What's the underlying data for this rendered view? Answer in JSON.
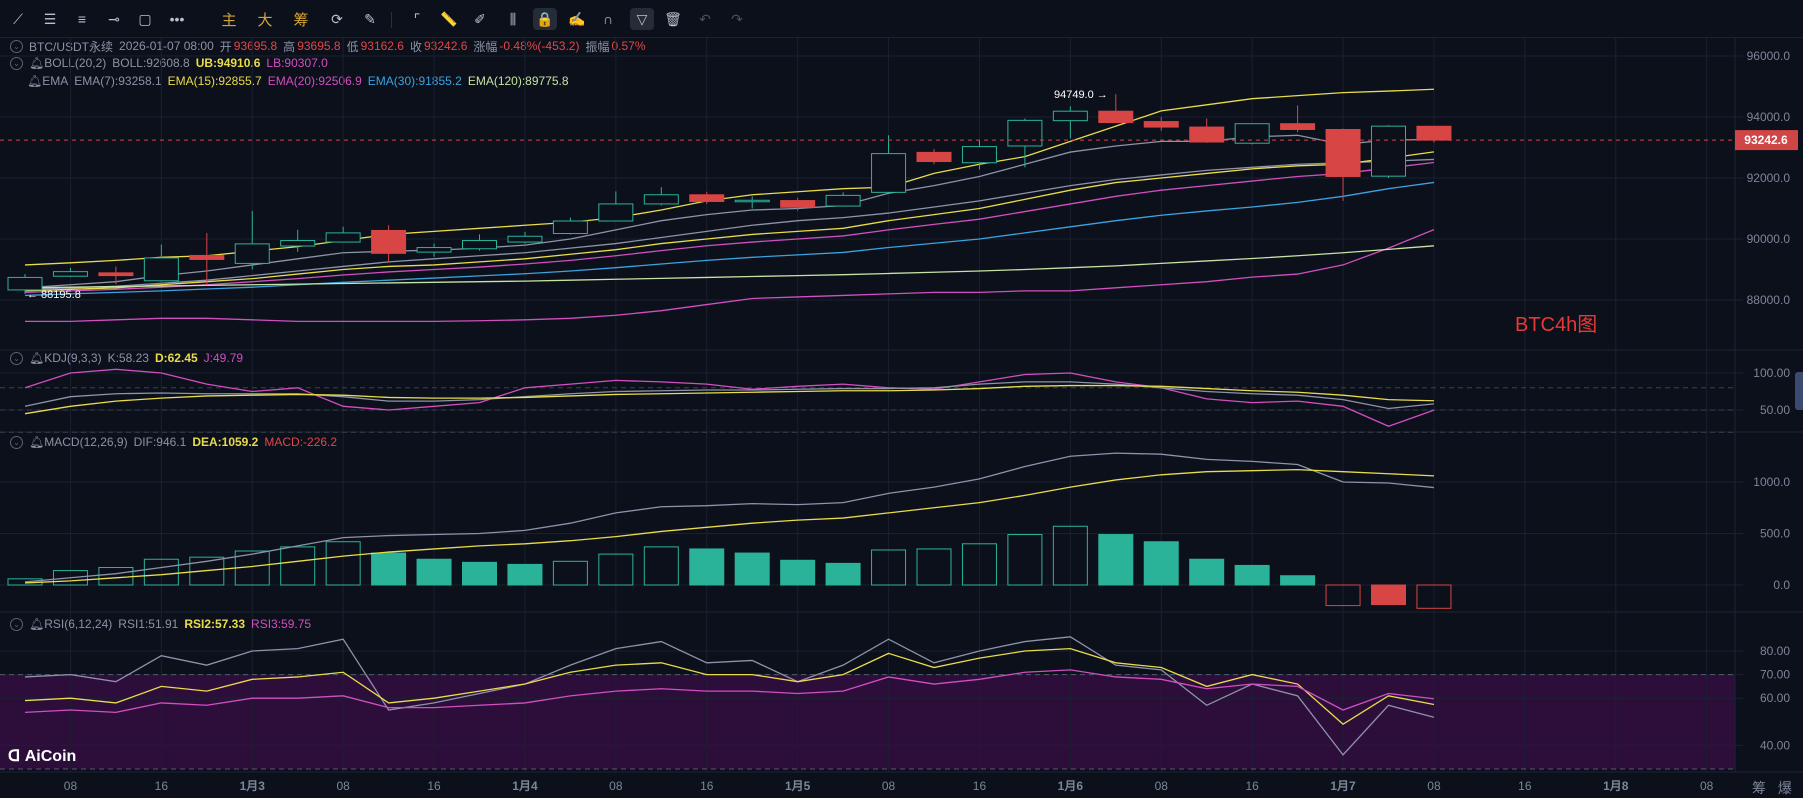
{
  "toolbar": {
    "items": [
      {
        "name": "trend-line-icon",
        "glyph": "⟋"
      },
      {
        "name": "parallel-channel-icon",
        "glyph": "☰"
      },
      {
        "name": "horizontal-lines-icon",
        "glyph": "≡"
      },
      {
        "name": "horizontal-ray-icon",
        "glyph": "⊸"
      },
      {
        "name": "rectangle-icon",
        "glyph": "▢"
      },
      {
        "name": "more-icon",
        "glyph": "•••"
      },
      {
        "name": "main-force-button",
        "glyph": "主",
        "gold": true
      },
      {
        "name": "large-order-button",
        "glyph": "大",
        "gold": true
      },
      {
        "name": "chips-button",
        "glyph": "筹",
        "gold": true
      },
      {
        "name": "sync-drawing-icon",
        "glyph": "⟳"
      },
      {
        "name": "draw-settings-icon",
        "glyph": "✎"
      },
      {
        "name": "bookmark-icon",
        "glyph": "⌜"
      },
      {
        "name": "ruler-icon",
        "glyph": "📏"
      },
      {
        "name": "pen-icon",
        "glyph": "✐"
      },
      {
        "name": "candle-measure-icon",
        "glyph": "⫼"
      },
      {
        "name": "lock-icon",
        "glyph": "🔒",
        "active": true
      },
      {
        "name": "edit-note-icon",
        "glyph": "✍"
      },
      {
        "name": "magnet-icon",
        "glyph": "∩"
      },
      {
        "name": "filter-icon",
        "glyph": "▽",
        "active": true
      },
      {
        "name": "trash-icon",
        "glyph": "🗑"
      },
      {
        "name": "undo-icon",
        "glyph": "↶",
        "dim": true
      },
      {
        "name": "redo-icon",
        "glyph": "↷",
        "dim": true
      }
    ]
  },
  "header": {
    "symbol": "BTC/USDT永续",
    "time": "2026-01-07 08:00",
    "open_label": "开",
    "open": "93695.8",
    "high_label": "高",
    "high": "93695.8",
    "low_label": "低",
    "low": "93162.6",
    "close_label": "收",
    "close": "93242.6",
    "change_label": "涨幅",
    "change": "-0.48%(-453.2)",
    "amplitude_label": "振幅",
    "amplitude": "0.57%"
  },
  "boll": {
    "name": "BOLL(20,2)",
    "mid": "BOLL:92608.8",
    "ub": "UB:94910.6",
    "lb": "LB:90307.0"
  },
  "ema": {
    "name": "EMA",
    "e7": "EMA(7):93258.1",
    "e15": "EMA(15):92855.7",
    "e20": "EMA(20):92506.9",
    "e30": "EMA(30):91855.2",
    "e120": "EMA(120):89775.8"
  },
  "kdj": {
    "name": "KDJ(9,3,3)",
    "k": "K:58.23",
    "d": "D:62.45",
    "j": "J:49.79"
  },
  "macd": {
    "name": "MACD(12,26,9)",
    "dif": "DIF:946.1",
    "dea": "DEA:1059.2",
    "macd": "MACD:-226.2"
  },
  "rsi": {
    "name": "RSI(6,12,24)",
    "r1": "RSI1:51.91",
    "r2": "RSI2:57.33",
    "r3": "RSI3:59.75"
  },
  "annotations": {
    "high_label": "94749.0 →",
    "low_label": "← 88195.8",
    "current_price": "93242.6",
    "chart_note": "BTC4h图"
  },
  "watermark": "AiCoin",
  "bottom_right": "筹 爆",
  "colors": {
    "up": "#2bb39a",
    "down": "#d84545",
    "yellow": "#e8dc4a",
    "magenta": "#d14fc0",
    "blue": "#3ba3e0",
    "green": "#c5e3a3",
    "gray": "#8d93a8",
    "band": "#2d0e3b"
  },
  "chart_data": [
    {
      "type": "candlestick",
      "title": "BTC/USDT永续 4h",
      "ylim": [
        86500,
        96800
      ],
      "y_ticks": [
        "96000.0",
        "94000.0",
        "92000.0",
        "90000.0",
        "88000.0"
      ],
      "y_tick_values": [
        96000,
        94000,
        92000,
        90000,
        88000
      ],
      "x_ticks": [
        "08",
        "16",
        "1月3",
        "08",
        "16",
        "1月4",
        "08",
        "16",
        "1月5",
        "08",
        "16",
        "1月6",
        "08",
        "16",
        "1月7",
        "08",
        "16",
        "1月8",
        "08"
      ],
      "ohlc": [
        [
          88330,
          88850,
          88196,
          88740
        ],
        [
          88780,
          89050,
          88750,
          88930
        ],
        [
          88890,
          89100,
          88520,
          88800
        ],
        [
          88630,
          89820,
          88600,
          89380
        ],
        [
          89460,
          90200,
          88480,
          89330
        ],
        [
          89200,
          90920,
          89000,
          89840
        ],
        [
          89770,
          90300,
          89580,
          89950
        ],
        [
          89900,
          90400,
          89900,
          90200
        ],
        [
          90280,
          90450,
          89280,
          89530
        ],
        [
          89570,
          89850,
          89420,
          89720
        ],
        [
          89680,
          90150,
          89620,
          89950
        ],
        [
          89900,
          90230,
          89850,
          90090
        ],
        [
          90180,
          90700,
          90150,
          90590
        ],
        [
          90590,
          91560,
          90590,
          91150
        ],
        [
          91150,
          91700,
          91100,
          91450
        ],
        [
          91450,
          91550,
          91150,
          91230
        ],
        [
          91240,
          91400,
          91000,
          91270
        ],
        [
          91260,
          91350,
          90930,
          91040
        ],
        [
          91080,
          91530,
          91060,
          91430
        ],
        [
          91530,
          93400,
          91530,
          92800
        ],
        [
          92840,
          92950,
          92450,
          92540
        ],
        [
          92500,
          93250,
          92280,
          93030
        ],
        [
          93050,
          93950,
          92350,
          93890
        ],
        [
          93880,
          94350,
          93300,
          94190
        ],
        [
          94190,
          94749,
          93800,
          93820
        ],
        [
          93850,
          94000,
          93550,
          93670
        ],
        [
          93670,
          93950,
          93150,
          93180
        ],
        [
          93140,
          93800,
          93100,
          93780
        ],
        [
          93780,
          94380,
          93500,
          93590
        ],
        [
          93590,
          93620,
          91250,
          92050
        ],
        [
          92060,
          93730,
          92000,
          93700
        ],
        [
          93695.8,
          93695.8,
          93162.6,
          93242.6
        ]
      ],
      "series": [
        {
          "name": "BOLL UB",
          "color": "yellow",
          "values": [
            89150,
            89220,
            89300,
            89400,
            89450,
            89600,
            89750,
            89950,
            90150,
            90250,
            90350,
            90450,
            90550,
            90700,
            90950,
            91250,
            91450,
            91550,
            91650,
            91700,
            92150,
            92450,
            92700,
            93200,
            93700,
            94200,
            94400,
            94600,
            94700,
            94800,
            94850,
            94911
          ]
        },
        {
          "name": "BOLL",
          "color": "gray",
          "values": [
            88350,
            88400,
            88450,
            88550,
            88650,
            88800,
            88950,
            89100,
            89250,
            89350,
            89450,
            89550,
            89700,
            89850,
            90050,
            90250,
            90450,
            90600,
            90700,
            90850,
            91050,
            91250,
            91500,
            91750,
            91950,
            92100,
            92250,
            92350,
            92450,
            92500,
            92550,
            92609
          ]
        },
        {
          "name": "BOLL LB",
          "color": "magenta",
          "values": [
            87300,
            87300,
            87350,
            87400,
            87400,
            87350,
            87300,
            87300,
            87300,
            87300,
            87320,
            87350,
            87400,
            87500,
            87650,
            87850,
            88050,
            88100,
            88150,
            88200,
            88250,
            88250,
            88300,
            88300,
            88400,
            88500,
            88600,
            88750,
            88850,
            89150,
            89700,
            90307
          ]
        },
        {
          "name": "EMA(7)",
          "color": "gray",
          "values": [
            88400,
            88500,
            88600,
            88800,
            88950,
            89150,
            89350,
            89550,
            89600,
            89630,
            89700,
            89800,
            90000,
            90300,
            90600,
            90800,
            90950,
            91000,
            91100,
            91500,
            91750,
            92050,
            92450,
            92850,
            93050,
            93200,
            93200,
            93350,
            93400,
            93100,
            93250,
            93258
          ]
        },
        {
          "name": "EMA(15)",
          "color": "yellow",
          "values": [
            88300,
            88350,
            88400,
            88500,
            88600,
            88700,
            88850,
            89000,
            89100,
            89150,
            89250,
            89350,
            89500,
            89650,
            89850,
            90000,
            90150,
            90250,
            90350,
            90600,
            90800,
            91000,
            91300,
            91600,
            91850,
            92000,
            92150,
            92300,
            92400,
            92450,
            92650,
            92856
          ]
        },
        {
          "name": "EMA(20)",
          "color": "magenta",
          "values": [
            88250,
            88300,
            88350,
            88420,
            88500,
            88600,
            88700,
            88820,
            88920,
            89000,
            89080,
            89180,
            89300,
            89450,
            89620,
            89780,
            89900,
            90000,
            90100,
            90300,
            90480,
            90650,
            90900,
            91150,
            91400,
            91600,
            91750,
            91900,
            92050,
            92150,
            92330,
            92507
          ]
        },
        {
          "name": "EMA(30)",
          "color": "blue",
          "values": [
            88150,
            88200,
            88250,
            88300,
            88360,
            88420,
            88500,
            88580,
            88650,
            88720,
            88790,
            88860,
            88950,
            89060,
            89180,
            89300,
            89400,
            89480,
            89560,
            89720,
            89860,
            90000,
            90200,
            90400,
            90600,
            90780,
            90920,
            91050,
            91200,
            91400,
            91650,
            91855
          ]
        },
        {
          "name": "EMA(120)",
          "color": "green",
          "values": [
            88400,
            88420,
            88440,
            88460,
            88480,
            88500,
            88520,
            88540,
            88560,
            88580,
            88600,
            88620,
            88650,
            88680,
            88710,
            88740,
            88770,
            88800,
            88830,
            88870,
            88910,
            88950,
            89000,
            89060,
            89120,
            89200,
            89280,
            89360,
            89450,
            89550,
            89660,
            89776
          ]
        }
      ]
    },
    {
      "type": "line",
      "title": "KDJ(9,3,3)",
      "ylim": [
        19,
        112
      ],
      "y_ticks": [
        "100.00",
        "50.00"
      ],
      "y_tick_values": [
        100,
        50
      ],
      "series": [
        {
          "name": "J",
          "color": "magenta",
          "values": [
            80,
            100,
            105,
            100,
            85,
            75,
            80,
            55,
            50,
            55,
            60,
            80,
            85,
            90,
            88,
            85,
            78,
            82,
            85,
            80,
            78,
            88,
            98,
            100,
            88,
            80,
            65,
            60,
            62,
            55,
            28,
            49.79
          ]
        },
        {
          "name": "K",
          "color": "gray",
          "values": [
            55,
            68,
            72,
            73,
            72,
            72,
            72,
            68,
            62,
            62,
            64,
            68,
            72,
            75,
            76,
            77,
            77,
            78,
            79,
            79,
            80,
            85,
            88,
            88,
            85,
            80,
            75,
            72,
            70,
            64,
            52,
            58.23
          ]
        },
        {
          "name": "D",
          "color": "yellow",
          "values": [
            45,
            55,
            62,
            66,
            69,
            70,
            71,
            70,
            67,
            66,
            66,
            67,
            69,
            71,
            72,
            73,
            74,
            75,
            76,
            76,
            77,
            79,
            82,
            83,
            83,
            82,
            79,
            76,
            74,
            70,
            64,
            62.45
          ]
        }
      ]
    },
    {
      "type": "bar+line",
      "title": "MACD(12,26,9)",
      "ylim": [
        -450,
        1450
      ],
      "y_ticks": [
        "1000.0",
        "500.0",
        "0.0"
      ],
      "y_tick_values": [
        1000,
        500,
        0
      ],
      "histogram": [
        60,
        140,
        170,
        250,
        270,
        330,
        370,
        420,
        310,
        250,
        220,
        200,
        230,
        300,
        370,
        350,
        310,
        240,
        210,
        340,
        350,
        400,
        490,
        570,
        490,
        420,
        250,
        190,
        90,
        -200,
        -190,
        -226.2
      ],
      "series": [
        {
          "name": "DIF",
          "color": "gray",
          "values": [
            30,
            70,
            110,
            170,
            230,
            300,
            380,
            460,
            480,
            490,
            500,
            530,
            600,
            700,
            760,
            770,
            790,
            780,
            800,
            890,
            950,
            1030,
            1150,
            1250,
            1280,
            1270,
            1220,
            1200,
            1170,
            1000,
            990,
            946.1
          ]
        },
        {
          "name": "DEA",
          "color": "yellow",
          "values": [
            20,
            40,
            70,
            100,
            140,
            180,
            230,
            280,
            320,
            350,
            380,
            400,
            430,
            470,
            520,
            560,
            600,
            630,
            650,
            700,
            750,
            800,
            870,
            950,
            1020,
            1070,
            1100,
            1110,
            1120,
            1100,
            1080,
            1059.2
          ]
        }
      ]
    },
    {
      "type": "line",
      "title": "RSI(6,12,24)",
      "ylim": [
        28,
        95
      ],
      "band": [
        30,
        70
      ],
      "y_ticks": [
        "80.00",
        "70.00",
        "60.00",
        "40.00"
      ],
      "y_tick_values": [
        80,
        70,
        60,
        40
      ],
      "series": [
        {
          "name": "RSI1",
          "color": "gray",
          "values": [
            69,
            70,
            67,
            78,
            74,
            80,
            81,
            85,
            55,
            58,
            62,
            66,
            74,
            81,
            84,
            75,
            76,
            67,
            74,
            85,
            75,
            80,
            84,
            86,
            74,
            72,
            57,
            66,
            61,
            36,
            57,
            51.91
          ]
        },
        {
          "name": "RSI2",
          "color": "yellow",
          "values": [
            59,
            60,
            58,
            65,
            63,
            68,
            69,
            71,
            58,
            60,
            63,
            66,
            71,
            74,
            75,
            70,
            70,
            67,
            70,
            79,
            73,
            77,
            80,
            81,
            75,
            73,
            65,
            70,
            66,
            49,
            61,
            57.33
          ]
        },
        {
          "name": "RSI3",
          "color": "magenta",
          "values": [
            54,
            55,
            54,
            58,
            57,
            60,
            60,
            61,
            56,
            56,
            57,
            58,
            61,
            63,
            64,
            63,
            63,
            62,
            63,
            69,
            66,
            68,
            71,
            72,
            69,
            68,
            64,
            66,
            65,
            55,
            62,
            59.75
          ]
        }
      ]
    }
  ]
}
